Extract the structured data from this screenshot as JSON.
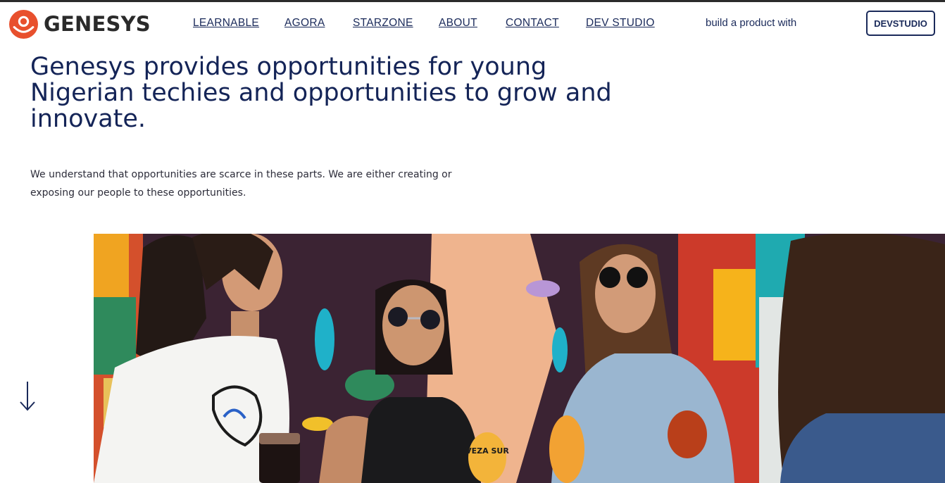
{
  "brand": {
    "name": "GENESYS",
    "accent": "#e8502d",
    "navy": "#1a2a5a"
  },
  "nav": [
    {
      "id": "learnable",
      "label": "LEARNABLE"
    },
    {
      "id": "agora",
      "label": "AGORA"
    },
    {
      "id": "starzone",
      "label": "STARZONE"
    },
    {
      "id": "about",
      "label": "ABOUT"
    },
    {
      "id": "contact",
      "label": "CONTACT"
    },
    {
      "id": "dev-studio",
      "label": "DEV STUDIO"
    }
  ],
  "header": {
    "build_text": "build a product with",
    "cta_label": "DEVSTUDIO"
  },
  "hero": {
    "title": "Genesys provides opportunities for young Nigerian techies and opportunities to grow and innovate.",
    "description": "We understand that opportunities are scarce in these parts. We are either creating or exposing our people to these opportunities."
  },
  "icons": {
    "logo": "genesys-logo-icon",
    "scroll": "arrow-down-icon"
  },
  "photo": {
    "cup_text": "VEZA SUR"
  }
}
